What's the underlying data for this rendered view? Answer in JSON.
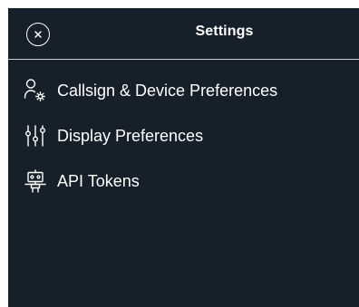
{
  "header": {
    "title": "Settings",
    "close_icon": "close-circle-icon"
  },
  "menu": {
    "items": [
      {
        "label": "Callsign & Device Preferences",
        "icon": "user-gear-icon"
      },
      {
        "label": "Display Preferences",
        "icon": "sliders-icon"
      },
      {
        "label": "API Tokens",
        "icon": "robot-icon"
      }
    ]
  },
  "colors": {
    "panel_background": "#15202b",
    "text": "#ffffff",
    "divider": "#c8cdd2"
  }
}
